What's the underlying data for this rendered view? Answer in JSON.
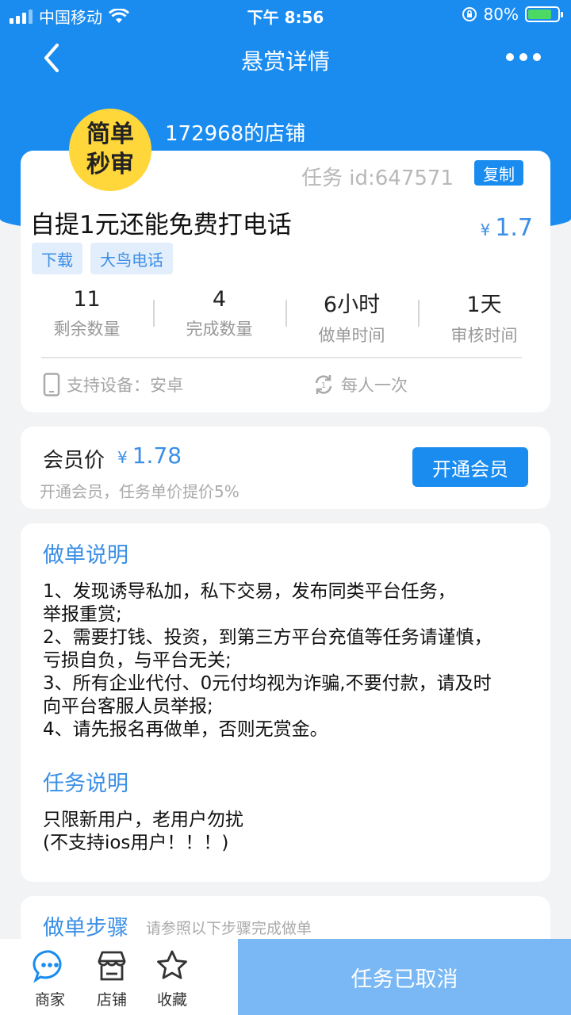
{
  "status_bar": {
    "carrier": "中国移动",
    "time": "下午 8:56",
    "battery": "80%"
  },
  "nav": {
    "title": "悬赏详情"
  },
  "badge": {
    "line1": "简单",
    "line2": "秒审"
  },
  "shop": {
    "name": "172968的店铺"
  },
  "task": {
    "id_text": "任务 id:647571",
    "copy_label": "复制",
    "title": "自提1元还能免费打电话",
    "currency": "¥",
    "price": "1.7",
    "tags": [
      "下载",
      "大鸟电话"
    ],
    "stats": [
      {
        "value": "11",
        "label": "剩余数量"
      },
      {
        "value": "4",
        "label": "完成数量"
      },
      {
        "value": "6小时",
        "label": "做单时间"
      },
      {
        "value": "1天",
        "label": "审核时间"
      }
    ],
    "device": "支持设备：安卓",
    "frequency": "每人一次"
  },
  "vip": {
    "label": "会员价",
    "currency": "¥",
    "price": "1.78",
    "tip": "开通会员，任务单价提价5%",
    "button": "开通会员"
  },
  "instructions": {
    "title": "做单说明",
    "lines": [
      "1、发现诱导私加，私下交易，发布同类平台任务，",
      "举报重赏;",
      "2、需要打钱、投资，到第三方平台充值等任务请谨慎，",
      "亏损自负，与平台无关;",
      "3、所有企业代付、0元付均视为诈骗,不要付款，请及时",
      "向平台客服人员举报;",
      "4、请先报名再做单，否则无赏金。"
    ]
  },
  "task_desc": {
    "title": "任务说明",
    "lines": [
      "只限新用户，老用户勿扰",
      "(不支持ios用户！！！)"
    ]
  },
  "steps": {
    "title": "做单步骤",
    "hint": "请参照以下步骤完成做单"
  },
  "bottom": {
    "tabs": [
      "商家",
      "店铺",
      "收藏"
    ],
    "cancel": "任务已取消"
  },
  "colors": {
    "primary": "#1a8cf0",
    "badge": "#ffd73a",
    "cancel": "#79b8f4"
  }
}
